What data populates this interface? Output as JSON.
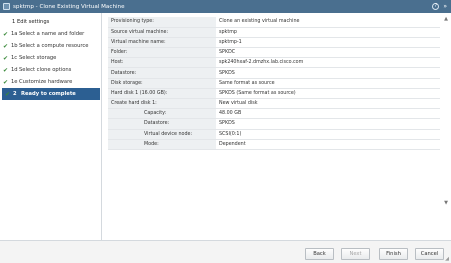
{
  "window": {
    "title": "spktmp - Clone Existing Virtual Machine",
    "help": "?",
    "expand": "»",
    "close": "×"
  },
  "sidebar": {
    "group_label": "1  Edit settings",
    "steps": [
      {
        "check": "✔",
        "num": "1a",
        "label": "Select a name and folder"
      },
      {
        "check": "✔",
        "num": "1b",
        "label": "Select a compute resource"
      },
      {
        "check": "✔",
        "num": "1c",
        "label": "Select storage"
      },
      {
        "check": "✔",
        "num": "1d",
        "label": "Select clone options"
      },
      {
        "check": "✔",
        "num": "1e",
        "label": "Customize hardware"
      },
      {
        "check": "✔",
        "num": "2",
        "label": "Ready to complete"
      }
    ]
  },
  "summary": {
    "rows": [
      {
        "key": "Provisioning type:",
        "value": "Clone an existing virtual machine"
      },
      {
        "key": "Source virtual machine:",
        "value": "spktmp"
      },
      {
        "key": "Virtual machine name:",
        "value": "spktmp-1"
      },
      {
        "key": "Folder:",
        "value": "SPKDC"
      },
      {
        "key": "Host:",
        "value": "spk240hxaf-2.dmzhx.lab.cisco.com"
      },
      {
        "key": "Datastore:",
        "value": "SPKDS"
      },
      {
        "key": "Disk storage:",
        "value": "Same format as source"
      },
      {
        "key": "Hard disk 1 (16.00 GB):",
        "value": "SPKDS (Same format as source)"
      },
      {
        "key": "Create hard disk 1:",
        "value": "New virtual disk"
      },
      {
        "key": "Capacity:",
        "value": "48.00 GB"
      },
      {
        "key": "Datastore:",
        "value": "SPKDS"
      },
      {
        "key": "Virtual device node:",
        "value": "SCSI(0:1)"
      },
      {
        "key": "Mode:",
        "value": "Dependent"
      }
    ]
  },
  "footer": {
    "back": "Back",
    "next": "Next",
    "finish": "Finish",
    "cancel": "Cancel"
  }
}
